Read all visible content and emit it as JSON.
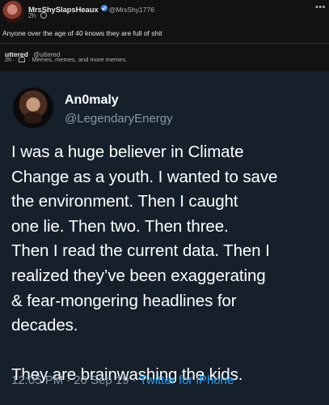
{
  "post": {
    "author_name": "MrsShySlapsHeaux",
    "author_handle": "@MrsShy1776",
    "time": "2h",
    "privacy_icon": "globe-icon",
    "more_icon": "more-icon",
    "text": "Anyone over the age of 40 knows they are full of shit"
  },
  "shared": {
    "author_name": "uttered",
    "author_handle": "@uttered",
    "time": "2h",
    "dot": "·",
    "audience_icon": "people-icon",
    "group_name": "Memes, memes, and more memes."
  },
  "tweet": {
    "name": "An0maly",
    "handle": "@LegendaryEnergy",
    "body_lines": [
      "I was a huge believer in Climate",
      "Change as a youth. I wanted to save",
      "the environment. Then I caught",
      "one lie. Then two. Then three.",
      "Then I read the current data. Then I",
      "realized they’ve been exaggerating",
      "& fear-mongering headlines for",
      "decades."
    ],
    "closing_line": "They are brainwashing the kids.",
    "time": "12:05 PM",
    "date": "20 Sep 19",
    "separator": "·",
    "source": "Twitter for iPhone"
  },
  "colors": {
    "app_background": "#121212",
    "tweet_background": "#15202b",
    "link_blue": "#1da1f2",
    "muted_text": "#8899a6"
  }
}
